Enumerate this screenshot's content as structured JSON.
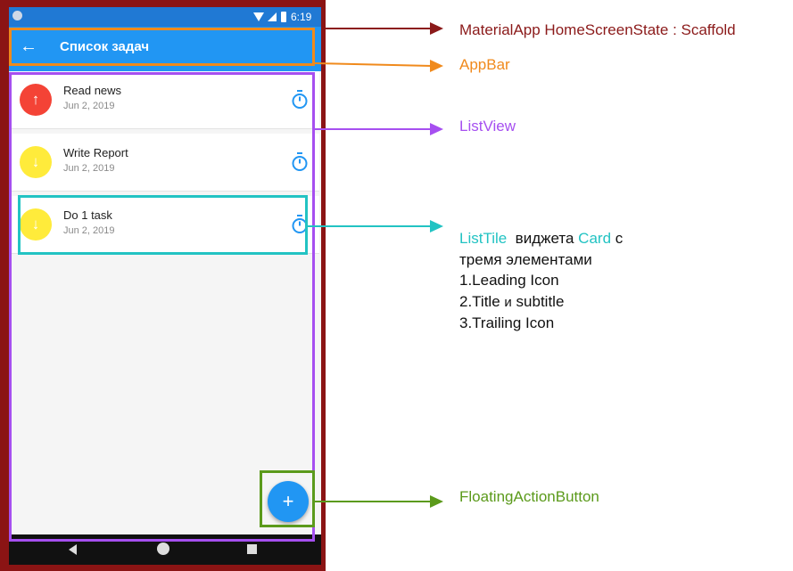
{
  "phone": {
    "status_bar": {
      "time": "6:19"
    },
    "app_bar": {
      "back_icon": "arrow-left-icon",
      "title": "Список задач"
    },
    "tasks": [
      {
        "title": "Read news",
        "subtitle": "Jun 2, 2019",
        "leading_icon": "arrow-up-icon",
        "leading_color": "#f44336",
        "trailing_icon": "timer-icon"
      },
      {
        "title": "Write Report",
        "subtitle": "Jun 2, 2019",
        "leading_icon": "arrow-down-icon",
        "leading_color": "#ffeb3b",
        "trailing_icon": "timer-icon"
      },
      {
        "title": "Do 1 task",
        "subtitle": "Jun 2, 2019",
        "leading_icon": "arrow-down-icon",
        "leading_color": "#ffeb3b",
        "trailing_icon": "timer-icon"
      }
    ],
    "fab": {
      "icon": "plus-icon",
      "color": "#2196f3"
    },
    "nav_bar": {
      "icons": [
        "nav-back-icon",
        "nav-home-icon",
        "nav-recent-icon"
      ]
    }
  },
  "annotations": {
    "material_app": {
      "text": "MaterialApp  HomeScreenState : Scaffold",
      "color": "#8b1a1a"
    },
    "app_bar": {
      "text": "AppBar",
      "color": "#f08a1c"
    },
    "list_view": {
      "text": "ListView",
      "color": "#a64ff0"
    },
    "list_tile": {
      "word1": "ListTile",
      "word2": "виджета",
      "word3": "Card",
      "word4": "с",
      "line2": "тремя элементами",
      "line3": "1.Leading Icon",
      "line4_part1": "2.Title",
      "line4_part2": "и",
      "line4_part3": "subtitle",
      "line5": "3.Trailing Icon",
      "color": "#22c3c3"
    },
    "fab": {
      "text": "FloatingActionButton",
      "color": "#5b9a1b"
    }
  }
}
